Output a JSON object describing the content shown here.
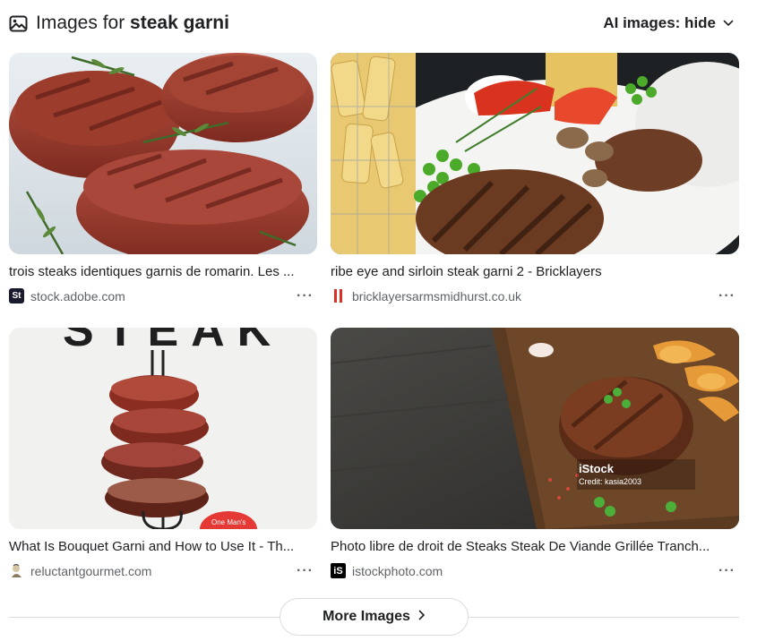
{
  "header": {
    "title_prefix": "Images for ",
    "query": "steak garni",
    "ai_toggle_label": "AI images: hide"
  },
  "results": [
    {
      "caption": "trois steaks identiques garnis de romarin. Les ...",
      "source": "stock.adobe.com",
      "favicon": "adobe-stock-icon",
      "more": "···",
      "favicon_text": "St"
    },
    {
      "caption": "ribe eye and sirloin steak garni 2 - Bricklayers",
      "source": "bricklayersarmsmidhurst.co.uk",
      "favicon": "bricklayers-icon",
      "more": "···"
    },
    {
      "caption": "What Is Bouquet Garni and How to Use It - Th...",
      "source": "reluctantgourmet.com",
      "favicon": "reluctant-gourmet-icon",
      "more": "···",
      "image_text": "STEAK",
      "badge_text": "One Man's"
    },
    {
      "caption": "Photo libre de droit de Steaks Steak De Viande Grillée Tranch...",
      "source": "istockphoto.com",
      "favicon": "istock-icon",
      "more": "···",
      "favicon_text": "iS",
      "watermark": "iStock",
      "credit": "Credit: kasia2003"
    }
  ],
  "footer": {
    "more_images_label": "More Images"
  },
  "colors": {
    "text": "#202124",
    "secondary": "#5f6368",
    "border": "#dadce0"
  },
  "image_numbers": [
    "1",
    "1",
    "1"
  ]
}
